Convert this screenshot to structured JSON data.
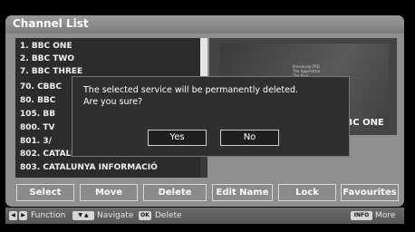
{
  "title": "Channel List",
  "channels": [
    "1. BBC ONE",
    "2. BBC TWO",
    "7. BBC THREE",
    "70. CBBC",
    "80. BBC",
    "105. BB",
    "800. TV",
    "801. 3/",
    "802. CATALUNYA RADIO",
    "803. CATALUNYA INFORMACIÓ"
  ],
  "preview": {
    "caption": "Previously FRD\nThe Apprentice\nThe Pool",
    "channel_name": "BBC ONE"
  },
  "dialog": {
    "message_line1": "The selected service will be permanently deleted.",
    "message_line2": "Are you sure?",
    "yes_label": "Yes",
    "no_label": "No"
  },
  "actions": {
    "select": "Select",
    "move": "Move",
    "delete": "Delete",
    "edit_name": "Edit Name",
    "lock": "Lock",
    "favourites": "Favourites"
  },
  "footer": {
    "function_label": "Function",
    "navigate_label": "Navigate",
    "ok_key": "OK",
    "delete_label": "Delete",
    "info_key": "INFO",
    "more_label": "More"
  }
}
